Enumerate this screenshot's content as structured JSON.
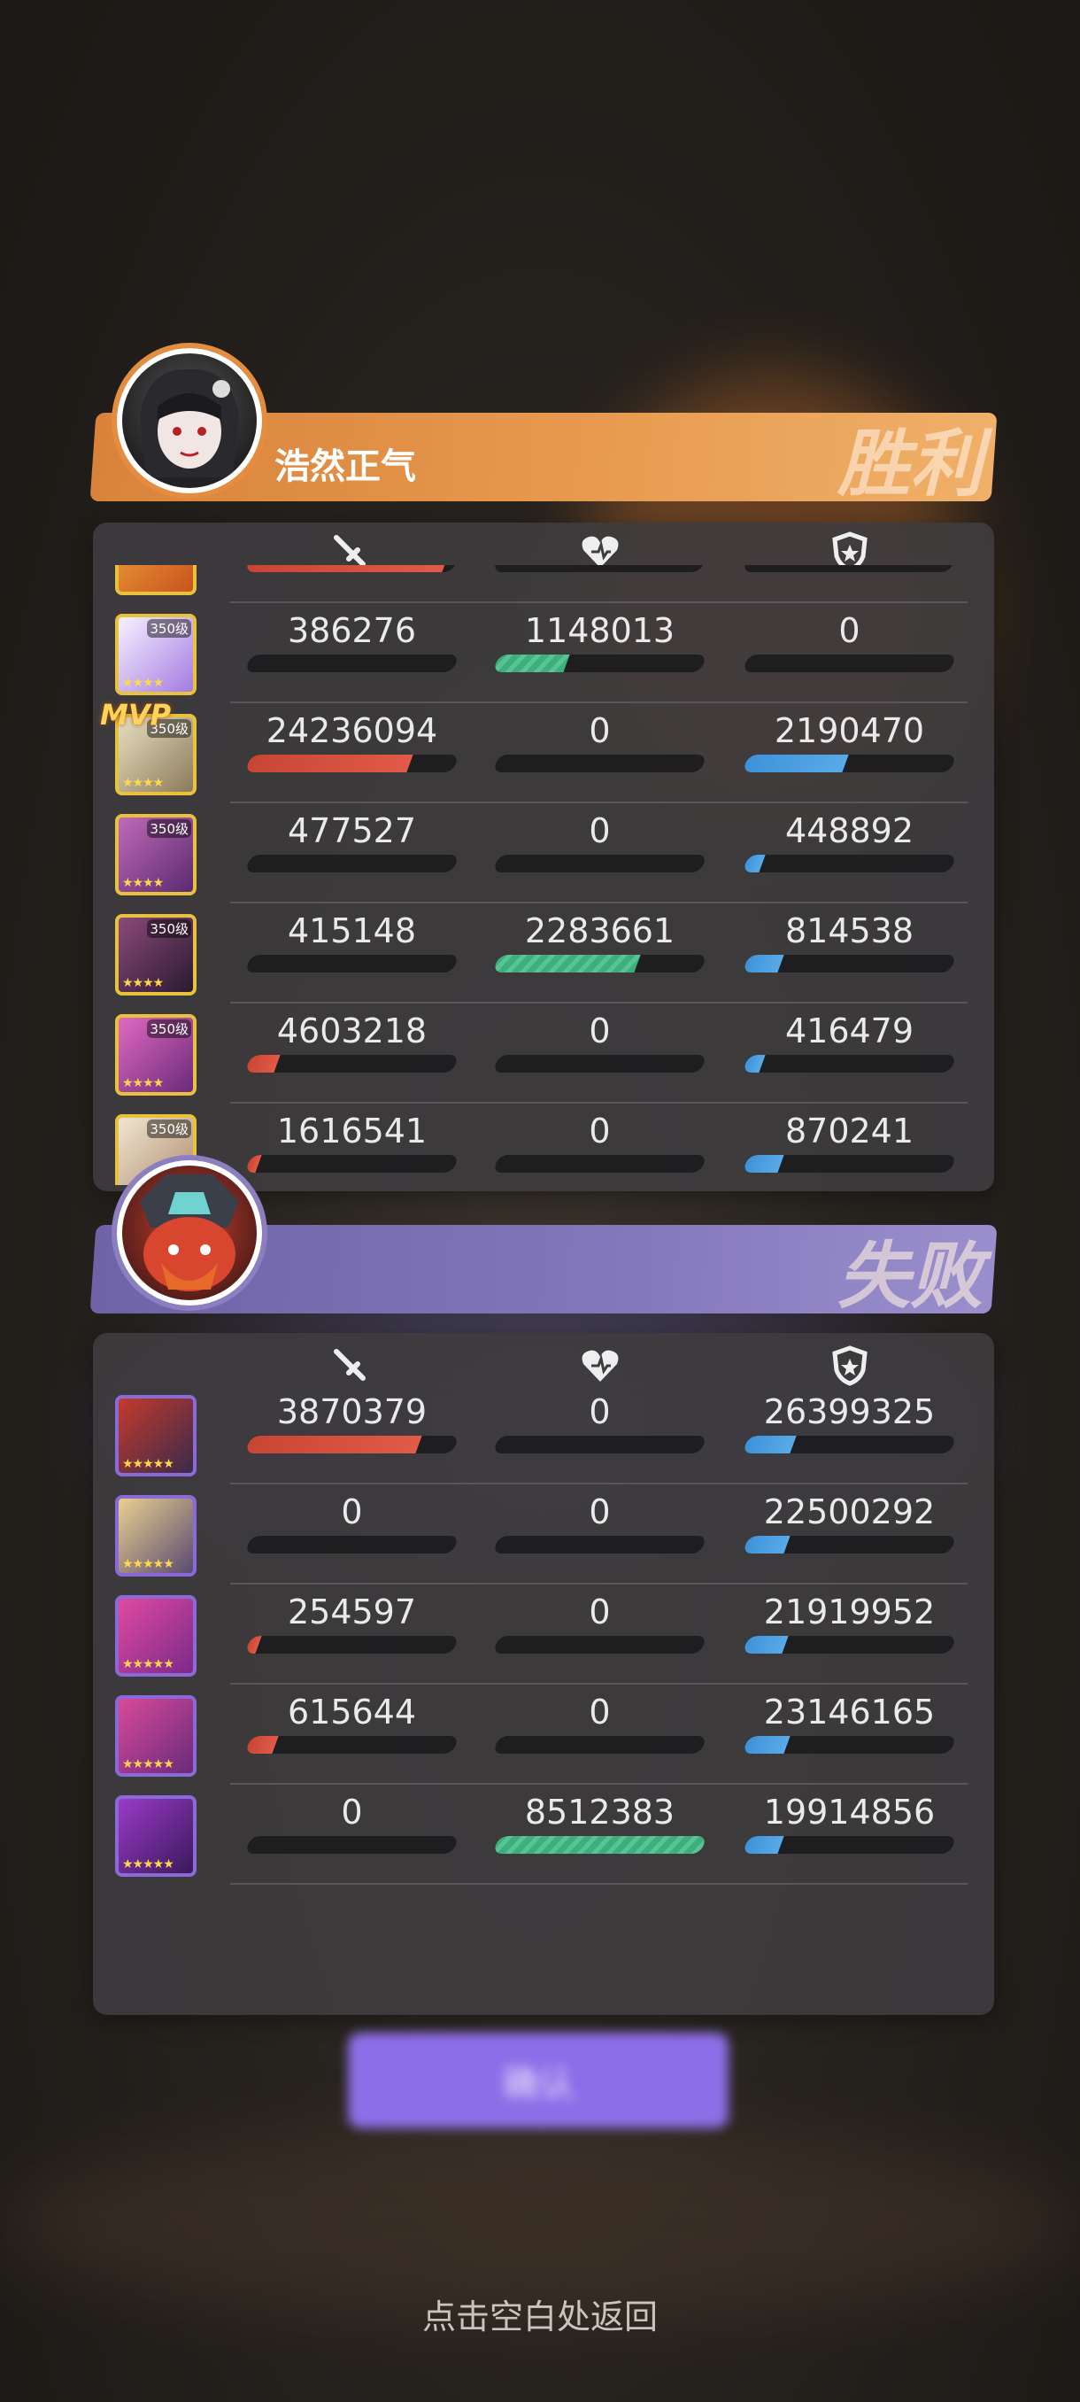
{
  "win_team": {
    "name": "浩然正气",
    "result": "胜利",
    "rows": [
      {
        "level": "",
        "mvp": false,
        "dmg": "",
        "heal": "",
        "shield": "",
        "dmg_frac": 0.95,
        "heal_frac": 0,
        "shield_frac": 0,
        "partial": true
      },
      {
        "level": "350级",
        "mvp": false,
        "dmg": "386276",
        "heal": "1148013",
        "shield": "0",
        "dmg_frac": 0.0,
        "heal_frac": 0.34,
        "shield_frac": 0.0
      },
      {
        "level": "350级",
        "mvp": true,
        "mvp_label": "MVP",
        "dmg": "24236094",
        "heal": "0",
        "shield": "2190470",
        "dmg_frac": 0.78,
        "heal_frac": 0,
        "shield_frac": 0.48
      },
      {
        "level": "350级",
        "mvp": false,
        "dmg": "477527",
        "heal": "0",
        "shield": "448892",
        "dmg_frac": 0.0,
        "heal_frac": 0,
        "shield_frac": 0.08
      },
      {
        "level": "350级",
        "mvp": false,
        "dmg": "415148",
        "heal": "2283661",
        "shield": "814538",
        "dmg_frac": 0.0,
        "heal_frac": 0.68,
        "shield_frac": 0.17
      },
      {
        "level": "350级",
        "mvp": false,
        "dmg": "4603218",
        "heal": "0",
        "shield": "416479",
        "dmg_frac": 0.14,
        "heal_frac": 0,
        "shield_frac": 0.08
      },
      {
        "level": "350级",
        "mvp": false,
        "dmg": "1616541",
        "heal": "0",
        "shield": "870241",
        "dmg_frac": 0.05,
        "heal_frac": 0,
        "shield_frac": 0.17
      }
    ]
  },
  "lose_team": {
    "result": "失败",
    "rows": [
      {
        "dmg": "3870379",
        "heal": "0",
        "shield": "26399325",
        "dmg_frac": 0.82,
        "heal_frac": 0,
        "shield_frac": 0.23
      },
      {
        "dmg": "0",
        "heal": "0",
        "shield": "22500292",
        "dmg_frac": 0,
        "heal_frac": 0,
        "shield_frac": 0.2
      },
      {
        "dmg": "254597",
        "heal": "0",
        "shield": "21919952",
        "dmg_frac": 0.05,
        "heal_frac": 0,
        "shield_frac": 0.19
      },
      {
        "dmg": "615644",
        "heal": "0",
        "shield": "23146165",
        "dmg_frac": 0.13,
        "heal_frac": 0,
        "shield_frac": 0.2
      },
      {
        "dmg": "0",
        "heal": "8512383",
        "shield": "19914856",
        "dmg_frac": 0,
        "heal_frac": 1.0,
        "shield_frac": 0.17
      }
    ]
  },
  "icons": {
    "damage": "sword-icon",
    "heal": "heart-icon",
    "shield": "shield-icon"
  },
  "colors": {
    "damage": "#e25a48",
    "heal": "#4fbb8a",
    "shield": "#4aa0e0",
    "win": "#e48d3f",
    "lose": "#8478bd"
  },
  "confirm_label": "确认",
  "back_hint": "点击空白处返回"
}
